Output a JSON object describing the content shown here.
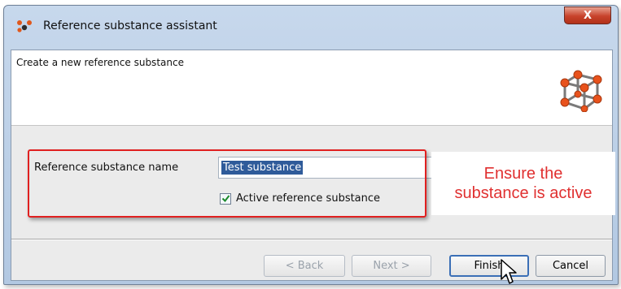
{
  "window": {
    "title": "Reference substance assistant",
    "close_label": "X"
  },
  "header": {
    "text": "Create a new reference substance",
    "icon": "molecule-cube-icon"
  },
  "form": {
    "name_label": "Reference substance name",
    "name_value": "Test substance",
    "active_label": "Active reference substance",
    "active_checked": true
  },
  "annotation": {
    "line1": "Ensure the",
    "line2": "substance is active",
    "color": "#e03030"
  },
  "buttons": {
    "back": "< Back",
    "next": "Next >",
    "finish": "Finish",
    "cancel": "Cancel"
  },
  "colors": {
    "highlight": "#e02020",
    "selection": "#2f5b9a",
    "close_button": "#c7422b"
  }
}
